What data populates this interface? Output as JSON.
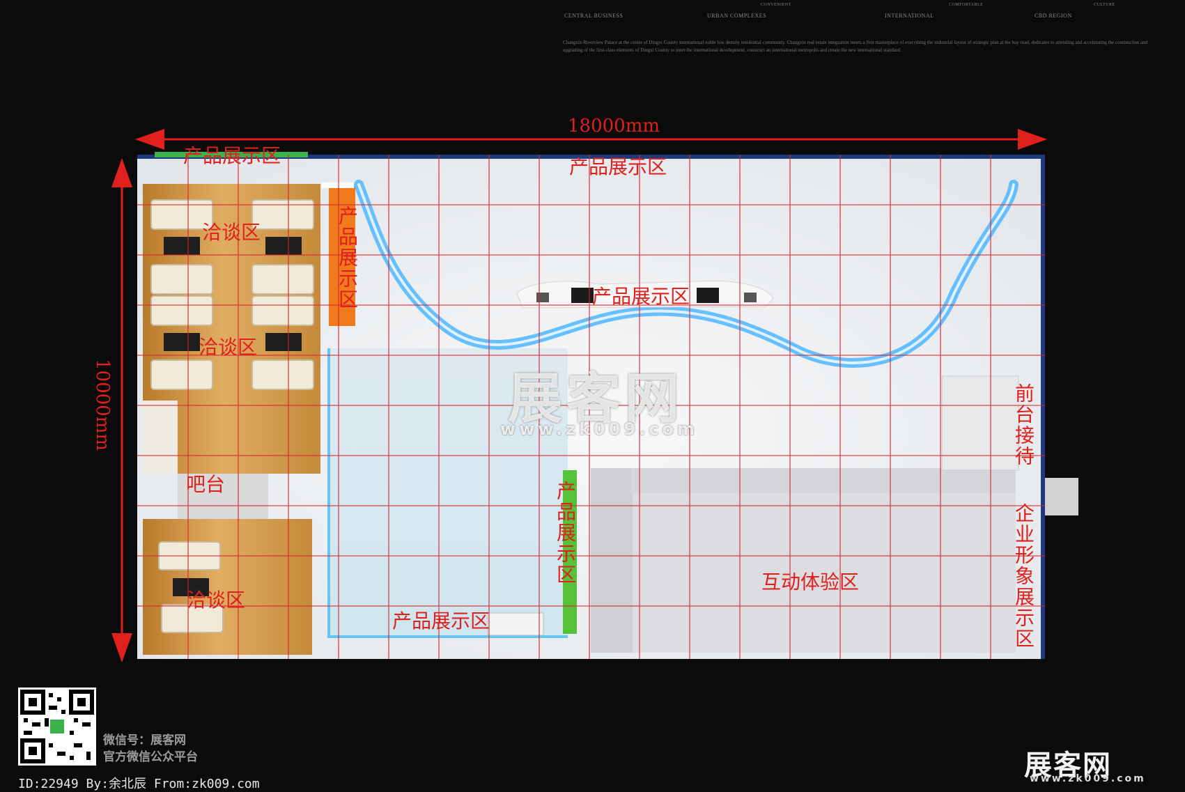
{
  "header": {
    "brand_items": [
      "CENTRAL BUSINESS",
      "URBAN COMPLEXES",
      "INTERNATIONAL",
      "CONVENIENT",
      "COMFORTABLE",
      "CBD REGION",
      "CULTURE"
    ],
    "description": "Changxin Riverview Palace at the center of Dingxi County international noble low density residential community. Changxin real estate integration meets a first masterpiece of everything the industrial layout of strategic plan at the bay road, dedicates to attending and accelerating the construction and upgrading of the first-class elements of Dingxi County to meet the international development, construct an international metropolis and create the new international standard."
  },
  "dimensions": {
    "width_label": "18000mm",
    "height_label": "10000mm"
  },
  "zones": {
    "product_top_left": "产品展示区",
    "product_top_center": "产品展示区",
    "product_center": "产品展示区",
    "product_left_column": "产品展示区",
    "product_bottom": "产品展示区",
    "product_mid_column": "产品展示区",
    "negotiation_1": "洽谈区",
    "negotiation_2": "洽谈区",
    "negotiation_3": "洽谈区",
    "bar": "吧台",
    "reception": "前台接待",
    "corporate_image": "企业形象展示区",
    "interactive": "互动体验区"
  },
  "watermark": {
    "logo": "展客网",
    "url": "www.zk009.com"
  },
  "footer": {
    "wechat_line1": "微信号：展客网",
    "wechat_line2": "官方微信公众平台",
    "id_line": "ID:22949 By:余北辰 From:zk009.com",
    "logo": "展客网",
    "logo_url": "www.zk009.com"
  },
  "colors": {
    "label_red": "#e0201c",
    "grid_red": "#d8242c",
    "wood": "#c98c3a",
    "led_blue": "#4fb6ff",
    "floor": "#e9edf0",
    "accent_orange": "#f07a1c",
    "accent_green": "#55c23a"
  }
}
